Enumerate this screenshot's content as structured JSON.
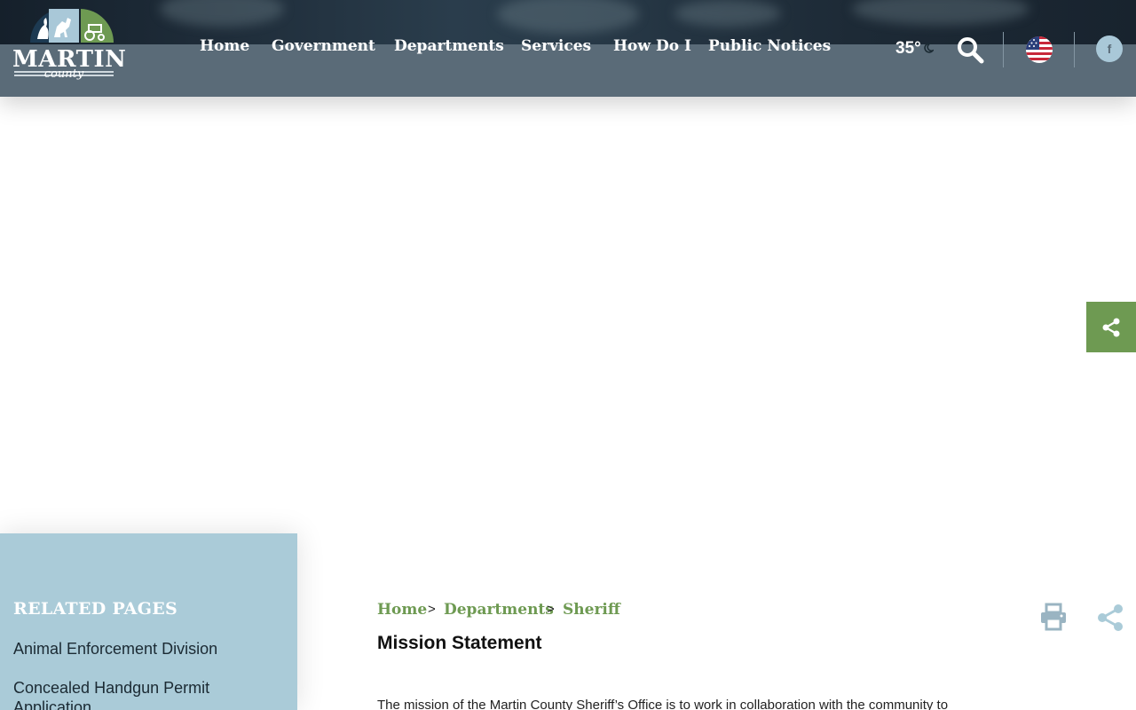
{
  "header": {
    "logo": {
      "title": "MARTIN",
      "subtitle": "county"
    },
    "nav": [
      {
        "label": "Home"
      },
      {
        "label": "Government"
      },
      {
        "label": "Departments"
      },
      {
        "label": "Services"
      },
      {
        "label": "How Do I"
      },
      {
        "label": "Public Notices"
      }
    ],
    "weather": {
      "temperature": "35°",
      "icon": "moon-icon"
    },
    "icons": [
      "search-icon",
      "us-flag-icon",
      "facebook-icon"
    ],
    "facebook_label": "f"
  },
  "floating_share": {
    "icon": "share-icon"
  },
  "sidebar": {
    "heading": "RELATED PAGES",
    "items": [
      {
        "label": "Animal Enforcement Division"
      },
      {
        "label": "Concealed Handgun Permit Application"
      }
    ]
  },
  "main": {
    "breadcrumb": [
      {
        "label": "Home"
      },
      {
        "label": "Departments"
      },
      {
        "label": "Sheriff"
      }
    ],
    "separator": ">",
    "tools": [
      "print-icon",
      "share-icon"
    ],
    "title": "Mission Statement",
    "body": "The mission of the Martin County Sheriff’s Office is to work in collaboration with the community to"
  },
  "colors": {
    "header": "#5a6b78",
    "accent_green": "#6e9a52",
    "sidebar": "#aacbd8",
    "white": "#ffffff"
  }
}
